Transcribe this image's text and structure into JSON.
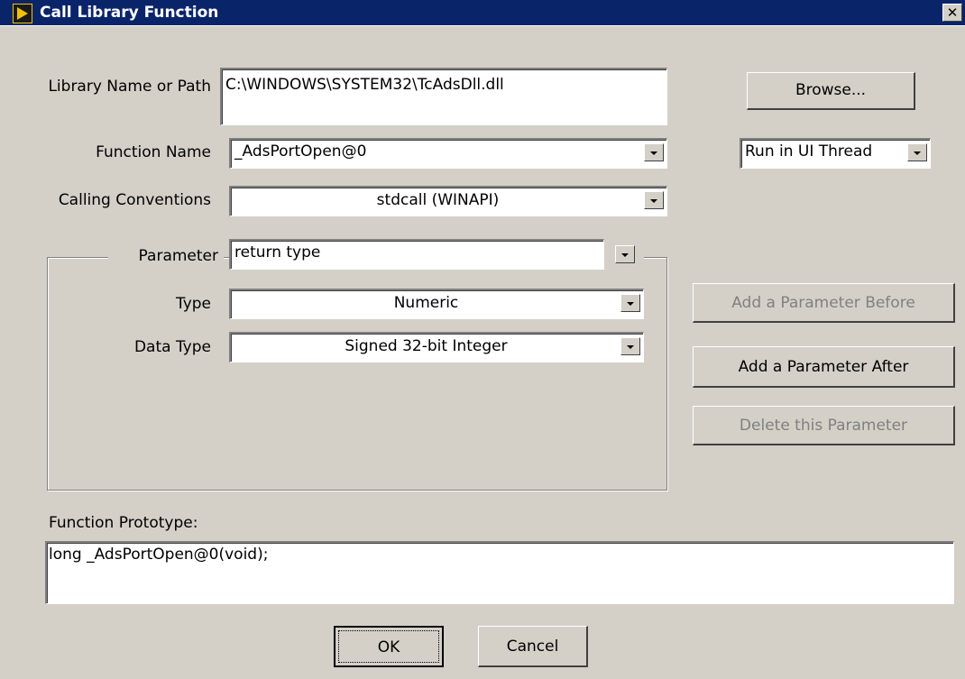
{
  "window": {
    "title": "Call Library Function",
    "close_glyph": "✕"
  },
  "library": {
    "label": "Library Name or Path",
    "value": "C:\\WINDOWS\\SYSTEM32\\TcAdsDll.dll"
  },
  "browse_button": "Browse...",
  "function_name": {
    "label": "Function Name",
    "value": "_AdsPortOpen@0"
  },
  "thread": {
    "value": "Run in UI Thread"
  },
  "calling_conventions": {
    "label": "Calling Conventions",
    "value": "stdcall (WINAPI)"
  },
  "parameter": {
    "label": "Parameter",
    "value": "return type",
    "type_label": "Type",
    "type_value": "Numeric",
    "data_type_label": "Data Type",
    "data_type_value": "Signed 32-bit Integer"
  },
  "buttons": {
    "add_before": "Add a Parameter Before",
    "add_after": "Add a Parameter After",
    "delete": "Delete this Parameter",
    "ok": "OK",
    "cancel": "Cancel"
  },
  "prototype": {
    "label": "Function Prototype:",
    "value": "long _AdsPortOpen@0(void);"
  },
  "icons": {
    "app": "labview-icon",
    "close": "close-icon",
    "dropdown": "chevron-down-icon"
  }
}
